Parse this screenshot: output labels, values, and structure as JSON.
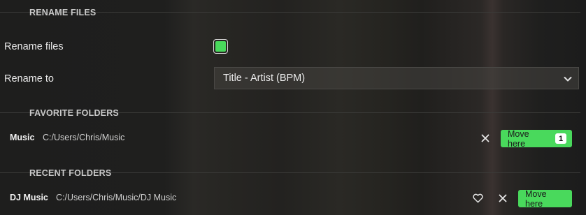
{
  "rename_section": {
    "title": "RENAME FILES",
    "rename_files_label": "Rename files",
    "rename_files_checked": true,
    "rename_to_label": "Rename to",
    "rename_to_value": "Title - Artist (BPM)"
  },
  "favorite_section": {
    "title": "FAVORITE FOLDERS",
    "items": [
      {
        "name": "Music",
        "path": "C:/Users/Chris/Music",
        "move_label": "Move here",
        "badge": "1"
      }
    ]
  },
  "recent_section": {
    "title": "RECENT FOLDERS",
    "items": [
      {
        "name": "DJ Music",
        "path": "C:/Users/Chris/Music/DJ Music",
        "move_label": "Move here"
      }
    ]
  },
  "colors": {
    "accent": "#49d95c",
    "background": "#1f1f1f"
  },
  "icons": {
    "dropdown": "chevron-down-icon",
    "remove": "close-icon",
    "favorite": "heart-icon"
  }
}
